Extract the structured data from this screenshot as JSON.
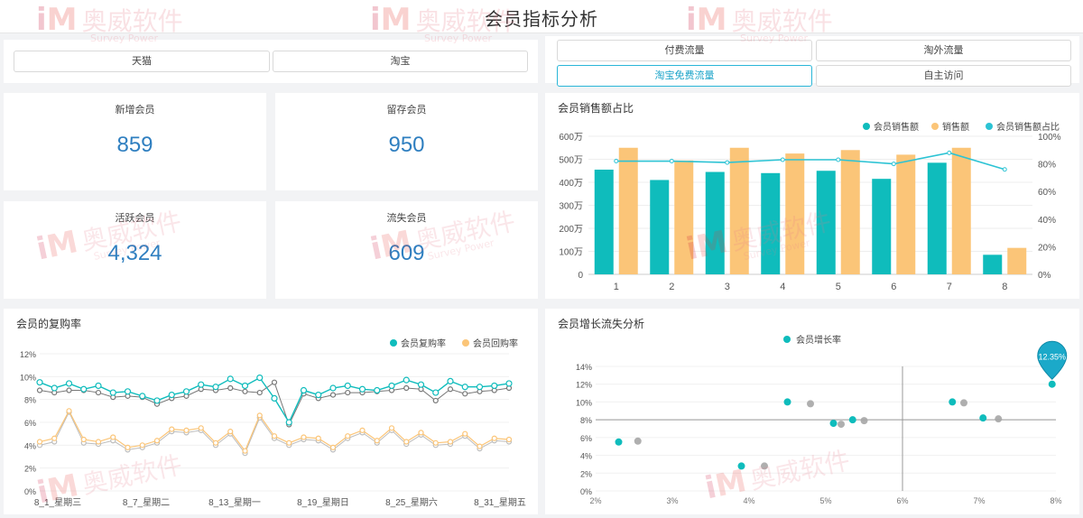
{
  "header": {
    "title": "会员指标分析"
  },
  "platform_filter": {
    "options": [
      "天猫",
      "淘宝"
    ]
  },
  "traffic_filter": {
    "options": [
      "付费流量",
      "淘外流量",
      "淘宝免费流量",
      "自主访问"
    ],
    "active": "淘宝免费流量"
  },
  "kpis": [
    {
      "label": "新增会员",
      "value": "859"
    },
    {
      "label": "留存会员",
      "value": "950"
    },
    {
      "label": "活跃会员",
      "value": "4,324"
    },
    {
      "label": "流失会员",
      "value": "609"
    }
  ],
  "watermark": {
    "brand": "奥威软件",
    "sub": "Survey Power"
  },
  "colors": {
    "teal": "#0fbcbc",
    "orange": "#fbc578",
    "line": "#2cc3d4",
    "accent": "#2f7fc0",
    "gray": "#a6a6a6"
  },
  "chart_data": [
    {
      "id": "sales-share",
      "type": "bar",
      "title": "会员销售额占比",
      "categories": [
        "1",
        "2",
        "3",
        "4",
        "5",
        "6",
        "7",
        "8"
      ],
      "y_ticks": [
        "0",
        "100万",
        "200万",
        "300万",
        "400万",
        "500万",
        "600万"
      ],
      "y2_ticks": [
        "0%",
        "20%",
        "40%",
        "60%",
        "80%",
        "100%"
      ],
      "ylim": [
        0,
        600
      ],
      "y2lim": [
        0,
        100
      ],
      "grid": true,
      "legend_position": "top-right",
      "series": [
        {
          "name": "会员销售额",
          "kind": "bar",
          "values": [
            455,
            410,
            445,
            440,
            450,
            415,
            485,
            85
          ]
        },
        {
          "name": "销售额",
          "kind": "bar",
          "values": [
            550,
            495,
            550,
            525,
            540,
            520,
            550,
            115
          ]
        },
        {
          "name": "会员销售额占比",
          "kind": "line",
          "axis": "right",
          "values": [
            82,
            82,
            81,
            83,
            83,
            80,
            88,
            76
          ]
        }
      ]
    },
    {
      "id": "repurchase-rate",
      "type": "line",
      "title": "会员的复购率",
      "x_tick_labels": [
        "8_1_星期三",
        "8_7_星期二",
        "8_13_星期一",
        "8_19_星期日",
        "8_25_星期六",
        "8_31_星期五"
      ],
      "y_ticks": [
        "0%",
        "2%",
        "4%",
        "6%",
        "8%",
        "10%",
        "12%"
      ],
      "ylim": [
        0,
        12
      ],
      "legend_position": "top-right",
      "series": [
        {
          "name": "会员复购率",
          "values": [
            9.5,
            9.0,
            9.4,
            8.9,
            9.2,
            8.6,
            8.7,
            8.3,
            7.9,
            8.4,
            8.7,
            9.3,
            9.1,
            9.8,
            9.2,
            9.9,
            8.1,
            6.0,
            8.8,
            8.4,
            9.0,
            9.2,
            8.9,
            8.8,
            9.2,
            9.7,
            9.3,
            8.6,
            9.6,
            9.1,
            9.1,
            9.2,
            9.4
          ]
        },
        {
          "name": "会员回购率",
          "values": [
            4.3,
            4.6,
            7.0,
            4.5,
            4.3,
            4.7,
            3.8,
            4.0,
            4.4,
            5.4,
            5.3,
            5.5,
            4.2,
            5.2,
            3.5,
            6.6,
            4.8,
            4.2,
            4.7,
            4.6,
            3.8,
            4.8,
            5.3,
            4.4,
            5.5,
            4.3,
            5.1,
            4.2,
            4.3,
            5.0,
            3.9,
            4.6,
            4.5
          ]
        },
        {
          "name": "",
          "values": [
            8.8,
            8.6,
            8.8,
            8.8,
            8.6,
            8.2,
            8.3,
            8.2,
            7.6,
            8.1,
            8.3,
            8.9,
            8.8,
            9.0,
            8.7,
            8.6,
            9.5,
            5.8,
            8.5,
            8.1,
            8.4,
            8.6,
            8.6,
            8.7,
            8.8,
            9.0,
            8.9,
            7.9,
            8.9,
            8.5,
            8.7,
            8.8,
            9.0
          ]
        },
        {
          "name": "",
          "values": [
            4.0,
            4.3,
            6.9,
            4.2,
            4.1,
            4.4,
            3.6,
            3.8,
            4.2,
            5.2,
            5.1,
            5.3,
            4.0,
            5.0,
            3.3,
            6.4,
            4.6,
            4.0,
            4.5,
            4.4,
            3.6,
            4.6,
            5.1,
            4.2,
            5.3,
            4.1,
            4.9,
            4.0,
            4.1,
            4.8,
            3.7,
            4.4,
            4.3
          ]
        }
      ]
    },
    {
      "id": "member-growth",
      "type": "scatter",
      "title": "会员增长流失分析",
      "legend": [
        "会员增长率"
      ],
      "legend_position": "top-center",
      "y_ticks": [
        "0%",
        "2%",
        "4%",
        "6%",
        "8%",
        "10%",
        "12%",
        "14%"
      ],
      "x_ticks": [
        "2%",
        "3%",
        "4%",
        "5%",
        "6%",
        "7%",
        "8%"
      ],
      "xlim": [
        2,
        8
      ],
      "ylim": [
        0,
        14
      ],
      "reference_lines": {
        "x": 6,
        "y": 8
      },
      "highlight": {
        "label": "12.35%",
        "x": 7.95,
        "y": 12.35
      },
      "points": [
        {
          "x": 2.3,
          "y": 5.5
        },
        {
          "x": 2.55,
          "y": 5.6,
          "muted": true
        },
        {
          "x": 3.9,
          "y": 2.8
        },
        {
          "x": 4.2,
          "y": 2.8,
          "muted": true
        },
        {
          "x": 4.5,
          "y": 10.0
        },
        {
          "x": 4.8,
          "y": 9.8,
          "muted": true
        },
        {
          "x": 5.1,
          "y": 7.6
        },
        {
          "x": 5.2,
          "y": 7.5,
          "muted": true
        },
        {
          "x": 5.35,
          "y": 8.0
        },
        {
          "x": 5.5,
          "y": 7.9,
          "muted": true
        },
        {
          "x": 6.65,
          "y": 10.0
        },
        {
          "x": 6.8,
          "y": 9.9,
          "muted": true
        },
        {
          "x": 7.05,
          "y": 8.2
        },
        {
          "x": 7.25,
          "y": 8.1,
          "muted": true
        },
        {
          "x": 7.95,
          "y": 12.0
        }
      ]
    }
  ]
}
